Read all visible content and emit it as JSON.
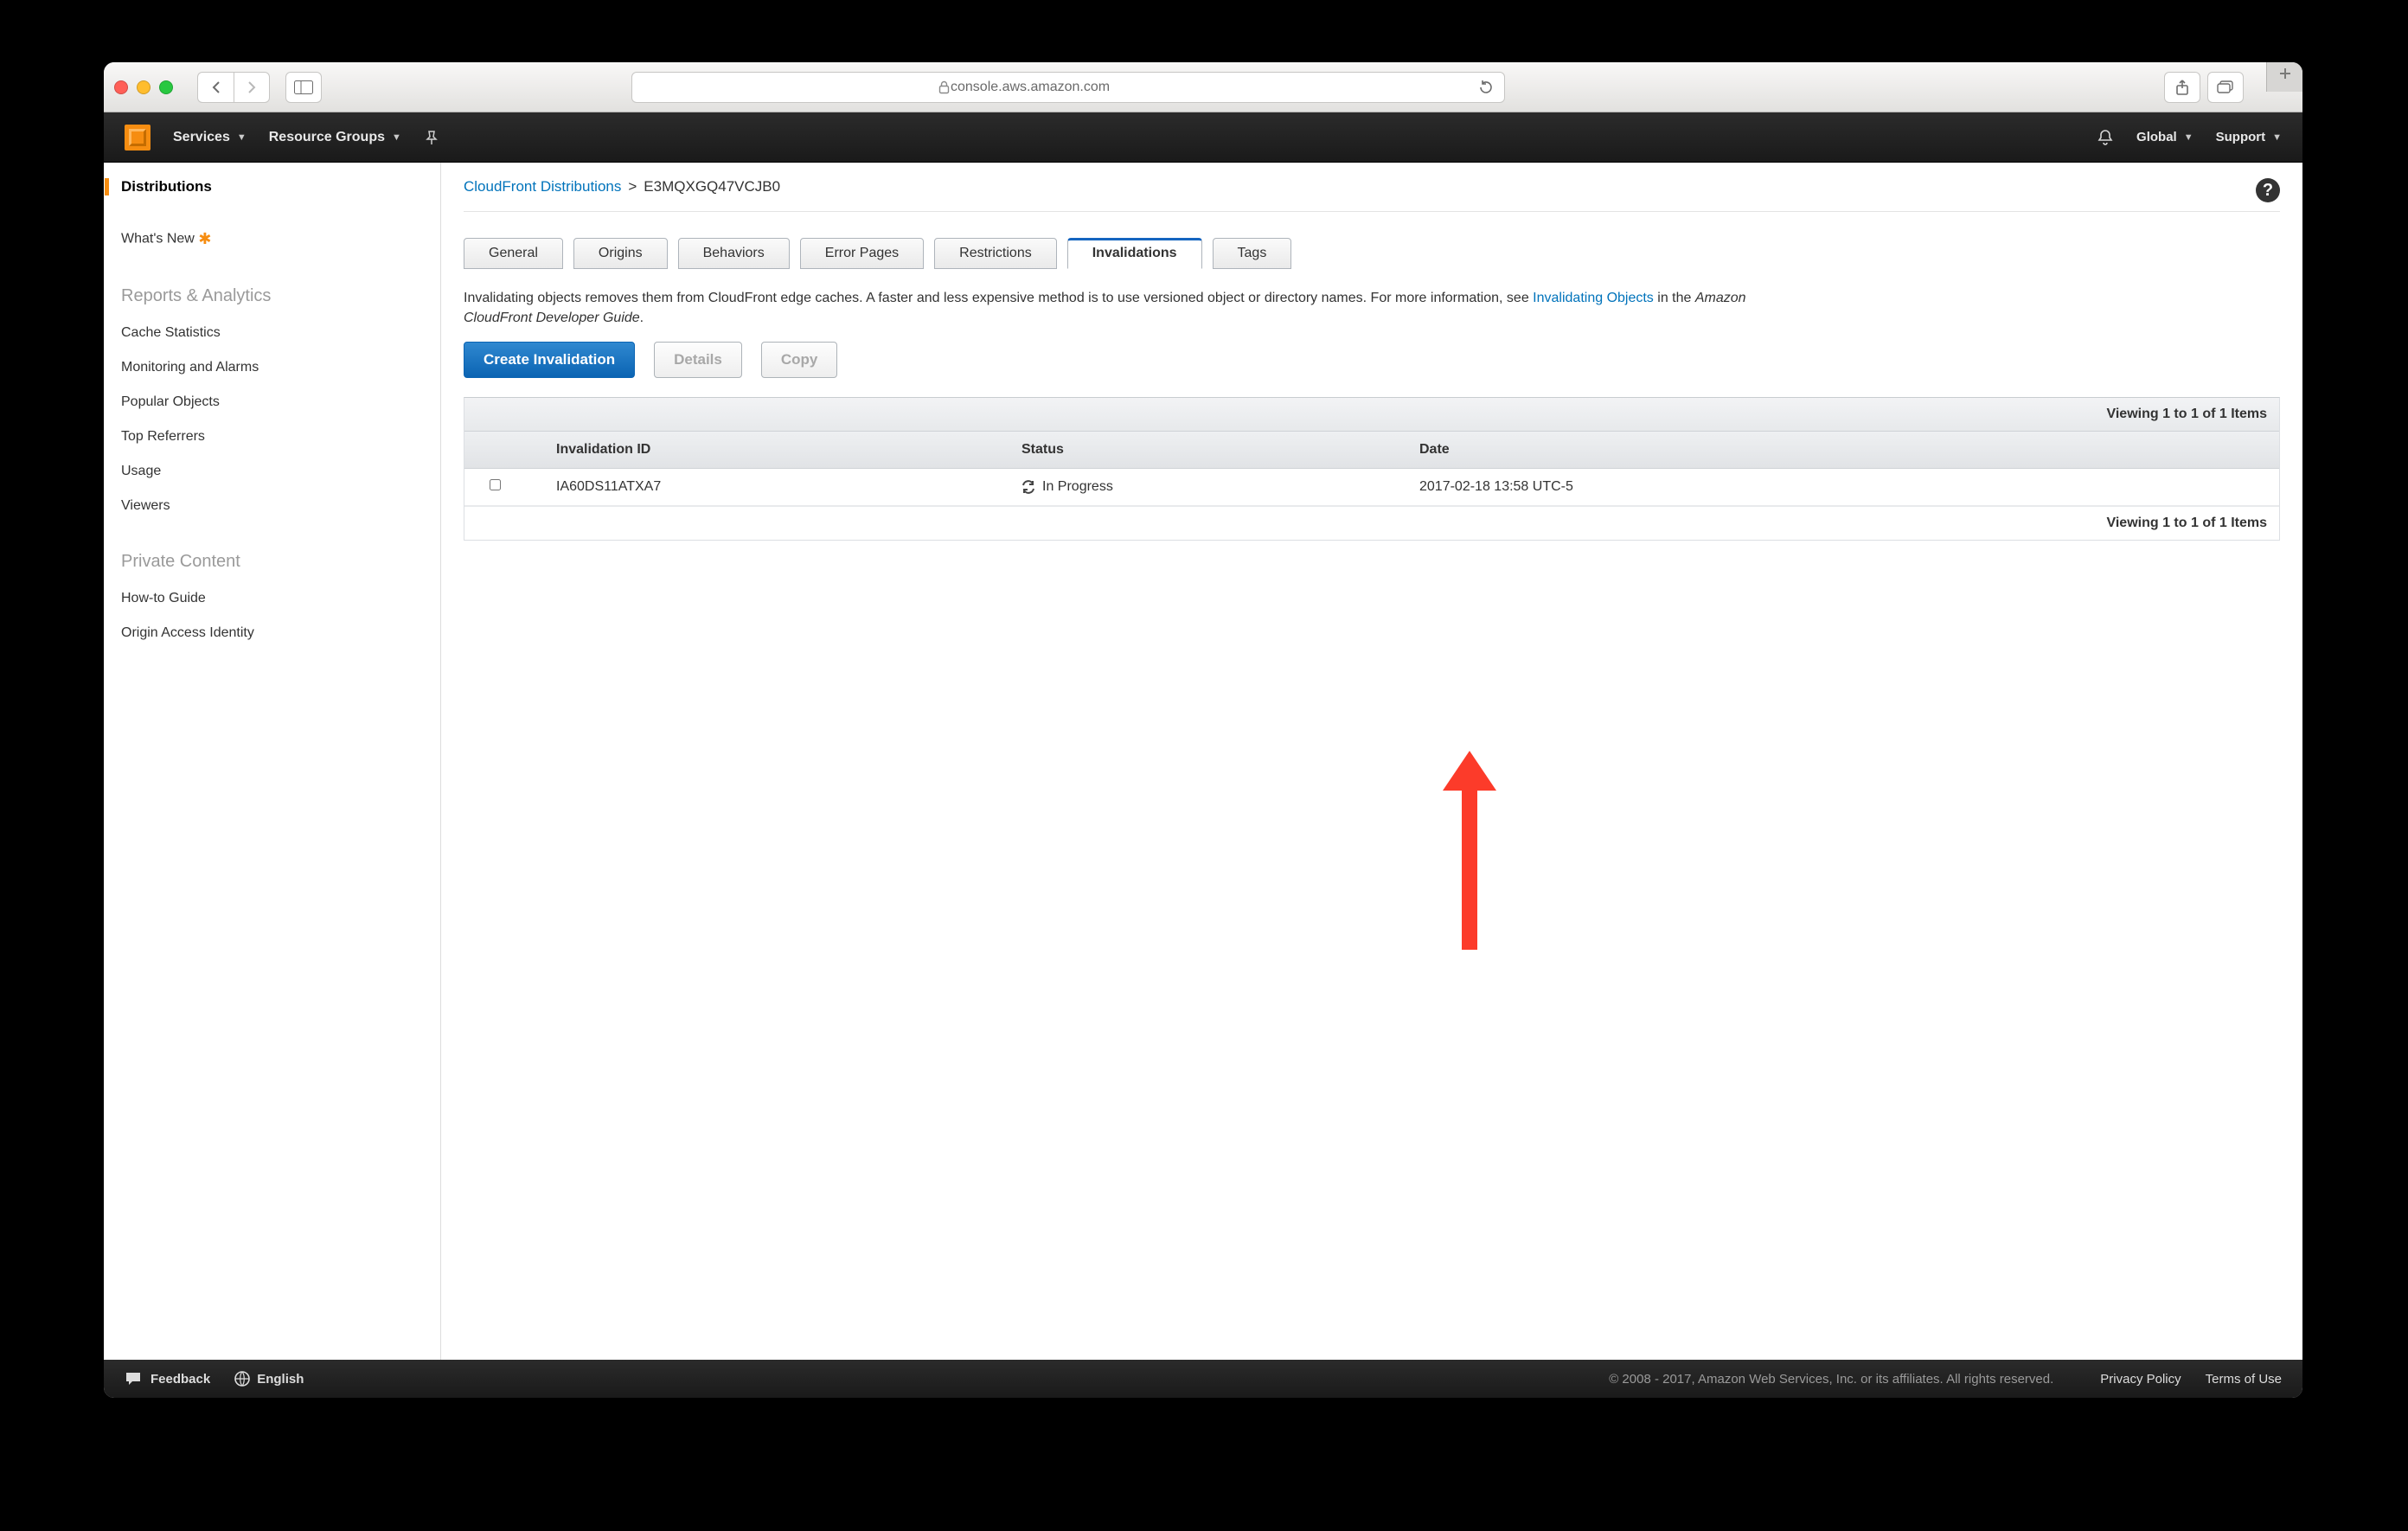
{
  "browser": {
    "url": "console.aws.amazon.com"
  },
  "topnav": {
    "services": "Services",
    "resource_groups": "Resource Groups",
    "region": "Global",
    "support": "Support"
  },
  "sidebar": {
    "active": "Distributions",
    "whats_new": "What's New",
    "sections": {
      "reports": {
        "title": "Reports & Analytics",
        "items": [
          "Cache Statistics",
          "Monitoring and Alarms",
          "Popular Objects",
          "Top Referrers",
          "Usage",
          "Viewers"
        ]
      },
      "private": {
        "title": "Private Content",
        "items": [
          "How-to Guide",
          "Origin Access Identity"
        ]
      }
    }
  },
  "breadcrumb": {
    "root": "CloudFront Distributions",
    "sep": ">",
    "current": "E3MQXGQ47VCJB0"
  },
  "tabs": [
    "General",
    "Origins",
    "Behaviors",
    "Error Pages",
    "Restrictions",
    "Invalidations",
    "Tags"
  ],
  "active_tab": "Invalidations",
  "description": {
    "pre": "Invalidating objects removes them from CloudFront edge caches. A faster and less expensive method is to use versioned object or directory names. For more information, see ",
    "link": "Invalidating Objects",
    "mid": " in the ",
    "em": "Amazon CloudFront Developer Guide",
    "end": "."
  },
  "buttons": {
    "create": "Create Invalidation",
    "details": "Details",
    "copy": "Copy"
  },
  "table": {
    "summary": "Viewing 1 to 1 of 1 Items",
    "headers": {
      "id": "Invalidation ID",
      "status": "Status",
      "date": "Date"
    },
    "rows": [
      {
        "id": "IA60DS11ATXA7",
        "status": "In Progress",
        "date": "2017-02-18 13:58 UTC-5"
      }
    ]
  },
  "footer": {
    "feedback": "Feedback",
    "language": "English",
    "copyright": "© 2008 - 2017, Amazon Web Services, Inc. or its affiliates. All rights reserved.",
    "privacy": "Privacy Policy",
    "terms": "Terms of Use"
  }
}
